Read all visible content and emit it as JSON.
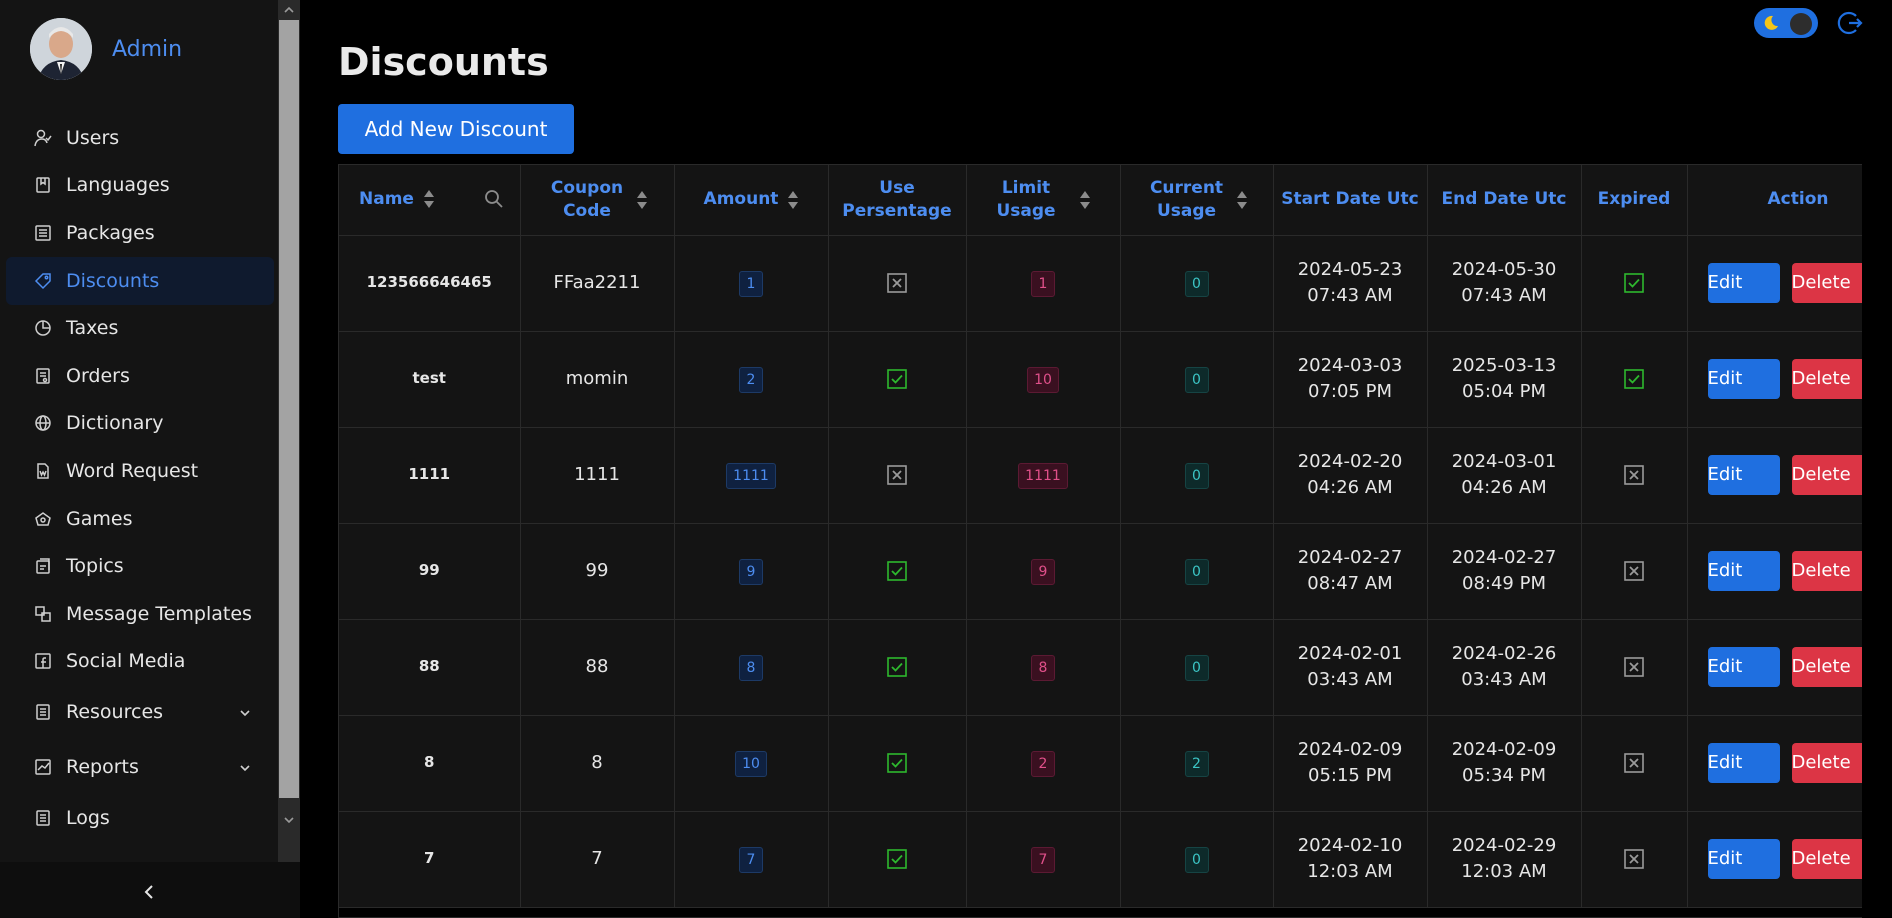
{
  "profile": {
    "name": "Admin"
  },
  "sidebar": {
    "items": [
      {
        "label": "Users",
        "icon": "users-icon"
      },
      {
        "label": "Languages",
        "icon": "book-icon"
      },
      {
        "label": "Packages",
        "icon": "package-icon"
      },
      {
        "label": "Discounts",
        "icon": "tag-icon",
        "active": true
      },
      {
        "label": "Taxes",
        "icon": "pie-icon"
      },
      {
        "label": "Orders",
        "icon": "receipt-icon"
      },
      {
        "label": "Dictionary",
        "icon": "globe-icon"
      },
      {
        "label": "Word Request",
        "icon": "doc-icon"
      },
      {
        "label": "Games",
        "icon": "gamepad-icon"
      },
      {
        "label": "Topics",
        "icon": "topics-icon"
      },
      {
        "label": "Message Templates",
        "icon": "template-icon"
      },
      {
        "label": "Social Media",
        "icon": "facebook-icon"
      },
      {
        "label": "Resources",
        "icon": "resources-icon",
        "expandable": true
      },
      {
        "label": "Reports",
        "icon": "chart-icon",
        "expandable": true
      },
      {
        "label": "Logs",
        "icon": "logs-icon"
      }
    ]
  },
  "page": {
    "title": "Discounts",
    "add_label": "Add New Discount"
  },
  "table": {
    "headers": {
      "name": "Name",
      "coupon": "Coupon Code",
      "amount": "Amount",
      "use_percentage": "Use Persentage",
      "limit": "Limit Usage",
      "current": "Current Usage",
      "start": "Start Date Utc",
      "end": "End Date Utc",
      "expired": "Expired",
      "action": "Action"
    },
    "edit_label": "Edit",
    "delete_label": "Delete",
    "rows": [
      {
        "name": "123566646465",
        "coupon": "FFaa2211",
        "amount": "1",
        "use_percentage": false,
        "limit": "1",
        "current": "0",
        "start_date": "2024-05-23",
        "start_time": "07:43 AM",
        "end_date": "2024-05-30",
        "end_time": "07:43 AM",
        "expired": true
      },
      {
        "name": "test",
        "coupon": "momin",
        "amount": "2",
        "use_percentage": true,
        "limit": "10",
        "current": "0",
        "start_date": "2024-03-03",
        "start_time": "07:05 PM",
        "end_date": "2025-03-13",
        "end_time": "05:04 PM",
        "expired": true
      },
      {
        "name": "1111",
        "coupon": "1111",
        "amount": "1111",
        "use_percentage": false,
        "limit": "1111",
        "current": "0",
        "start_date": "2024-02-20",
        "start_time": "04:26 AM",
        "end_date": "2024-03-01",
        "end_time": "04:26 AM",
        "expired": false
      },
      {
        "name": "99",
        "coupon": "99",
        "amount": "9",
        "use_percentage": true,
        "limit": "9",
        "current": "0",
        "start_date": "2024-02-27",
        "start_time": "08:47 AM",
        "end_date": "2024-02-27",
        "end_time": "08:49 PM",
        "expired": false
      },
      {
        "name": "88",
        "coupon": "88",
        "amount": "8",
        "use_percentage": true,
        "limit": "8",
        "current": "0",
        "start_date": "2024-02-01",
        "start_time": "03:43 AM",
        "end_date": "2024-02-26",
        "end_time": "03:43 AM",
        "expired": false
      },
      {
        "name": "8",
        "coupon": "8",
        "amount": "10",
        "use_percentage": true,
        "limit": "2",
        "current": "2",
        "start_date": "2024-02-09",
        "start_time": "05:15 PM",
        "end_date": "2024-02-09",
        "end_time": "05:34 PM",
        "expired": false
      },
      {
        "name": "7",
        "coupon": "7",
        "amount": "7",
        "use_percentage": true,
        "limit": "7",
        "current": "0",
        "start_date": "2024-02-10",
        "start_time": "12:03 AM",
        "end_date": "2024-02-29",
        "end_time": "12:03 AM",
        "expired": false
      }
    ]
  },
  "colors": {
    "accent": "#1f6fe0",
    "danger": "#dc3545",
    "check_green": "#2eb82e",
    "cross_gray": "#9a9a9a"
  }
}
